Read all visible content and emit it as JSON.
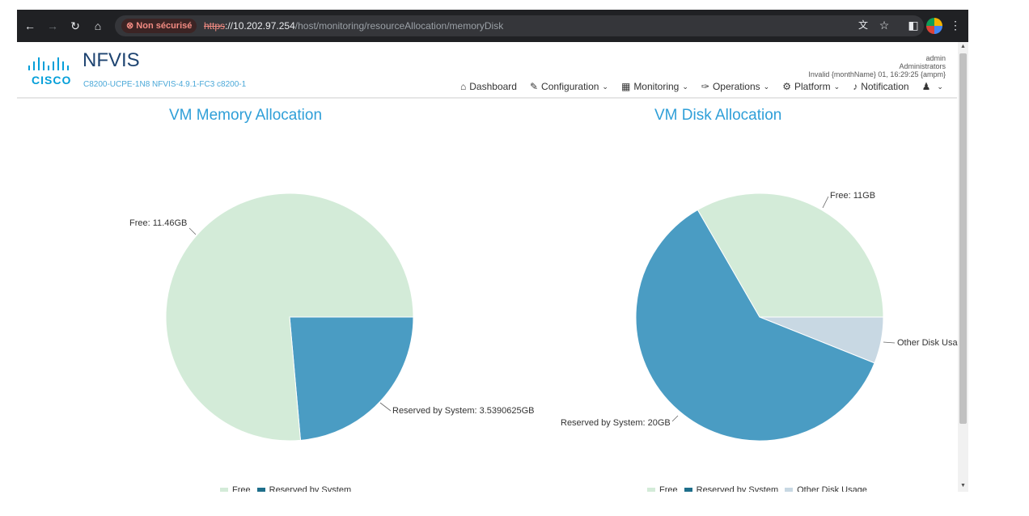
{
  "browser": {
    "security_label": "Non sécurisé",
    "url_scheme": "https",
    "url_host": "://10.202.97.254",
    "url_path": "/host/monitoring/resourceAllocation/memoryDisk"
  },
  "header": {
    "logo_text": "CISCO",
    "app_title": "NFVIS",
    "device_info": "C8200-UCPE-1N8 NFVIS-4.9.1-FC3 c8200-1",
    "user": "admin",
    "role": "Administrators",
    "datetime": "Invalid {monthName} 01, 16:29:25 {ampm}"
  },
  "menu": [
    {
      "label": "Dashboard",
      "icon": "home-icon",
      "glyph": "⌂",
      "chevron": false
    },
    {
      "label": "Configuration",
      "icon": "edit-icon",
      "glyph": "✎",
      "chevron": true
    },
    {
      "label": "Monitoring",
      "icon": "chart-icon",
      "glyph": "▦",
      "chevron": true
    },
    {
      "label": "Operations",
      "icon": "wrench-icon",
      "glyph": "✑",
      "chevron": true
    },
    {
      "label": "Platform",
      "icon": "cogs-icon",
      "glyph": "⚙",
      "chevron": true
    },
    {
      "label": "Notification",
      "icon": "bell-icon",
      "glyph": "♪",
      "chevron": false
    },
    {
      "label": "",
      "icon": "user-gear-icon",
      "glyph": "♟",
      "chevron": true
    }
  ],
  "colors": {
    "free": "#d3ebd8",
    "reserved": "#4a9cc3",
    "other": "#c8d8e3",
    "legend_reserved": "#1f6f8b"
  },
  "chart_data": [
    {
      "type": "pie",
      "title": "VM Memory Allocation",
      "unit": "GB",
      "slices": [
        {
          "name": "Free",
          "value": 11.46,
          "label": "Free: 11.46GB"
        },
        {
          "name": "Reserved by System",
          "value": 3.5390625,
          "label": "Reserved by System: 3.5390625GB"
        }
      ],
      "legend": [
        "Free",
        "Reserved by System"
      ],
      "legend_placement": "bottom"
    },
    {
      "type": "pie",
      "title": "VM Disk Allocation",
      "unit": "GB",
      "slices": [
        {
          "name": "Free",
          "value": 11,
          "label": "Free: 11GB"
        },
        {
          "name": "Other Disk Usage",
          "value": 2,
          "label": "Other Disk Usag"
        },
        {
          "name": "Reserved by System",
          "value": 20,
          "label": "Reserved by System: 20GB"
        }
      ],
      "legend": [
        "Free",
        "Reserved by System",
        "Other Disk Usage"
      ],
      "legend_placement": "bottom"
    }
  ]
}
